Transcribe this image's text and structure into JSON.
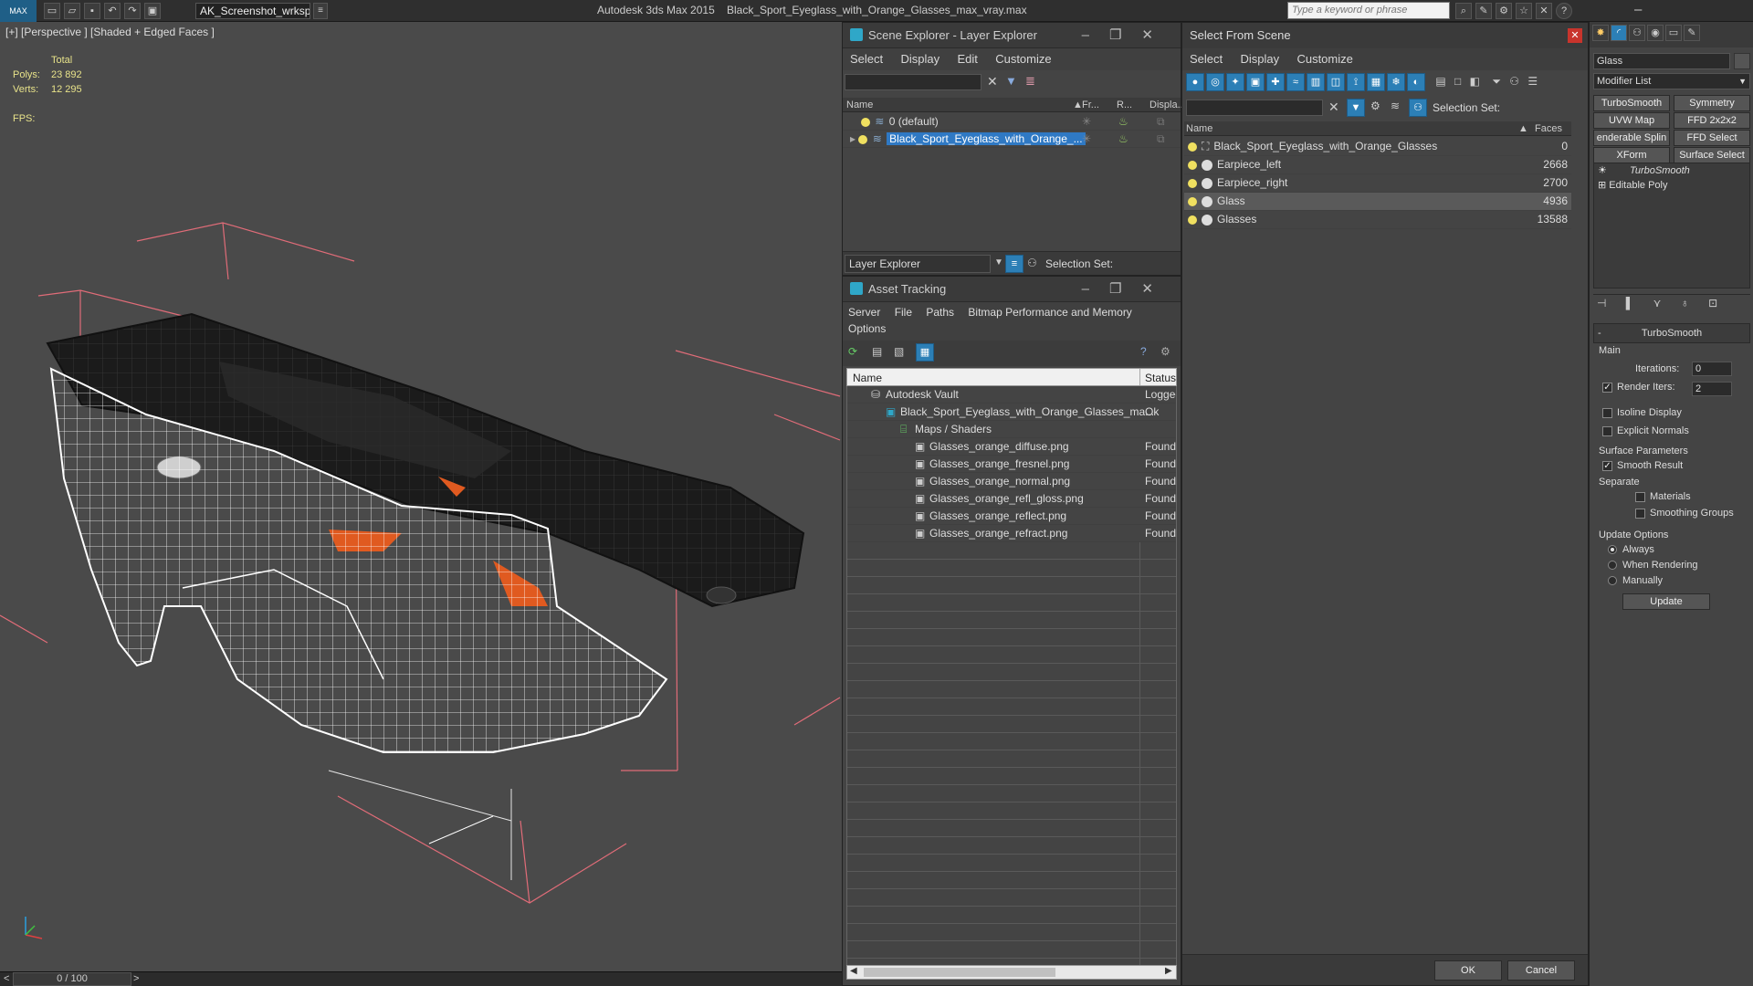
{
  "app": {
    "title": "Autodesk 3ds Max  2015",
    "file": "Black_Sport_Eyeglass_with_Orange_Glasses_max_vray.max",
    "workspace": "AK_Screenshot_wrksp",
    "search_placeholder": "Type a keyword or phrase",
    "logo": "MAX"
  },
  "viewport": {
    "label": "[+] [Perspective ] [Shaded + Edged Faces ]",
    "total_label": "Total",
    "polys_label": "Polys:",
    "polys_value": "23 892",
    "verts_label": "Verts:",
    "verts_value": "12 295",
    "fps_label": "FPS:"
  },
  "timeline": {
    "frame": "0 / 100",
    "prev": "<",
    "next": ">"
  },
  "scene_explorer": {
    "title": "Scene Explorer - Layer Explorer",
    "menu": [
      "Select",
      "Display",
      "Edit",
      "Customize"
    ],
    "columns": {
      "name": "Name",
      "frozen": "Fr...",
      "render": "R...",
      "display": "Displa..."
    },
    "rows": [
      {
        "name": "0 (default)"
      },
      {
        "name": "Black_Sport_Eyeglass_with_Orange_..."
      }
    ],
    "footer_label": "Layer Explorer",
    "selection_set": "Selection Set:"
  },
  "asset_tracking": {
    "title": "Asset Tracking",
    "menu": [
      "Server",
      "File",
      "Paths",
      "Bitmap Performance and Memory"
    ],
    "menu2": "Options",
    "columns": {
      "name": "Name",
      "status": "Status"
    },
    "rows": [
      {
        "name": "Autodesk Vault",
        "status": "Logged",
        "indent": 0
      },
      {
        "name": "Black_Sport_Eyeglass_with_Orange_Glasses_ma...",
        "status": "Ok",
        "indent": 1
      },
      {
        "name": "Maps / Shaders",
        "status": "",
        "indent": 2
      },
      {
        "name": "Glasses_orange_diffuse.png",
        "status": "Found",
        "indent": 3
      },
      {
        "name": "Glasses_orange_fresnel.png",
        "status": "Found",
        "indent": 3
      },
      {
        "name": "Glasses_orange_normal.png",
        "status": "Found",
        "indent": 3
      },
      {
        "name": "Glasses_orange_refl_gloss.png",
        "status": "Found",
        "indent": 3
      },
      {
        "name": "Glasses_orange_reflect.png",
        "status": "Found",
        "indent": 3
      },
      {
        "name": "Glasses_orange_refract.png",
        "status": "Found",
        "indent": 3
      }
    ]
  },
  "select_from_scene": {
    "title": "Select From Scene",
    "menu": [
      "Select",
      "Display",
      "Customize"
    ],
    "selection_set": "Selection Set:",
    "columns": {
      "name": "Name",
      "faces": "Faces"
    },
    "rows": [
      {
        "name": "Black_Sport_Eyeglass_with_Orange_Glasses",
        "faces": "0"
      },
      {
        "name": "Earpiece_left",
        "faces": "2668"
      },
      {
        "name": "Earpiece_right",
        "faces": "2700"
      },
      {
        "name": "Glass",
        "faces": "4936"
      },
      {
        "name": "Glasses",
        "faces": "13588"
      }
    ],
    "ok": "OK",
    "cancel": "Cancel"
  },
  "command_panel": {
    "object_name": "Glass",
    "modifier_list": "Modifier List",
    "mod_buttons": [
      "TurboSmooth",
      "Symmetry",
      "UVW Map",
      "FFD 2x2x2",
      "enderable Splin",
      "FFD Select",
      "XForm",
      "Surface Select"
    ],
    "stack": [
      "TurboSmooth",
      "Editable Poly"
    ],
    "rollout_title": "TurboSmooth",
    "main_label": "Main",
    "iterations_label": "Iterations:",
    "iterations_value": "0",
    "render_iters_label": "Render Iters:",
    "render_iters_value": "2",
    "isoline": "Isoline Display",
    "explicit_normals": "Explicit Normals",
    "surface_params": "Surface Parameters",
    "smooth_result": "Smooth Result",
    "separate": "Separate",
    "materials": "Materials",
    "smoothing_groups": "Smoothing Groups",
    "update_options": "Update Options",
    "always": "Always",
    "when_rendering": "When Rendering",
    "manually": "Manually",
    "update": "Update"
  }
}
